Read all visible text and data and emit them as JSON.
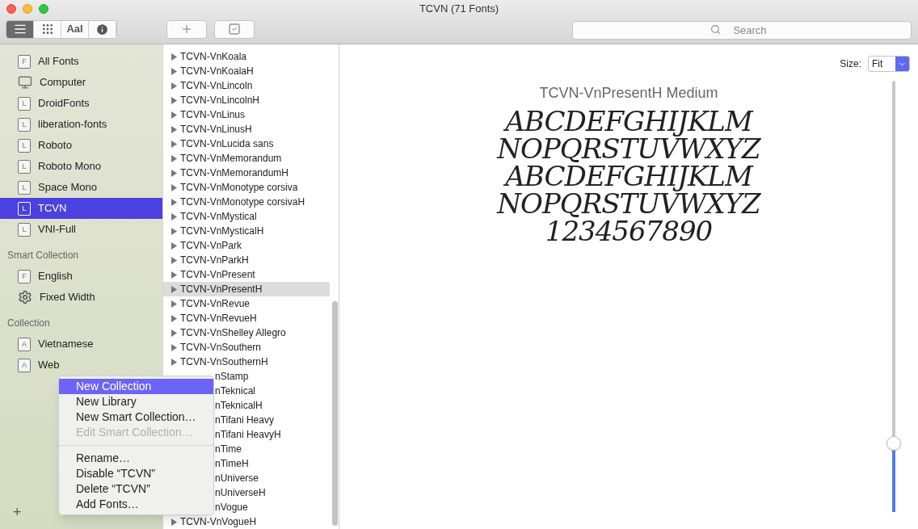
{
  "window": {
    "title": "TCVN (71 Fonts)"
  },
  "toolbar": {
    "view_modes": [
      {
        "kind": "list",
        "selected": true
      },
      {
        "kind": "grid",
        "selected": false
      },
      {
        "kind": "text",
        "label": "AaI",
        "selected": false
      },
      {
        "kind": "info",
        "selected": false
      }
    ],
    "actions": [
      {
        "kind": "add"
      },
      {
        "kind": "check"
      }
    ],
    "search": {
      "placeholder": "Search"
    }
  },
  "sidebar": {
    "sections": [
      {
        "items": [
          {
            "label": "All Fonts",
            "kind": "letter",
            "letter": "F",
            "selected": false
          },
          {
            "label": "Computer",
            "kind": "computer",
            "selected": false
          },
          {
            "label": "DroidFonts",
            "kind": "letter",
            "letter": "L",
            "selected": false
          },
          {
            "label": "liberation-fonts",
            "kind": "letter",
            "letter": "L",
            "selected": false
          },
          {
            "label": "Roboto",
            "kind": "letter",
            "letter": "L",
            "selected": false
          },
          {
            "label": "Roboto Mono",
            "kind": "letter",
            "letter": "L",
            "selected": false
          },
          {
            "label": "Space Mono",
            "kind": "letter",
            "letter": "L",
            "selected": false
          },
          {
            "label": "TCVN",
            "kind": "letter",
            "letter": "L",
            "selected": true
          },
          {
            "label": "VNI-Full",
            "kind": "letter",
            "letter": "L",
            "selected": false
          }
        ]
      },
      {
        "heading": "Smart Collection",
        "items": [
          {
            "label": "English",
            "kind": "letter",
            "letter": "F",
            "selected": false
          },
          {
            "label": "Fixed Width",
            "kind": "gear",
            "selected": false
          }
        ]
      },
      {
        "heading": "Collection",
        "items": [
          {
            "label": "Vietnamese",
            "kind": "letter",
            "letter": "A",
            "selected": false
          },
          {
            "label": "Web",
            "kind": "letter",
            "letter": "A",
            "selected": false
          }
        ]
      }
    ],
    "add_label": "+"
  },
  "font_list": [
    {
      "name": "TCVN-VnKoala",
      "selected": false
    },
    {
      "name": "TCVN-VnKoalaH",
      "selected": false
    },
    {
      "name": "TCVN-VnLincoln",
      "selected": false
    },
    {
      "name": "TCVN-VnLincolnH",
      "selected": false
    },
    {
      "name": "TCVN-VnLinus",
      "selected": false
    },
    {
      "name": "TCVN-VnLinusH",
      "selected": false
    },
    {
      "name": "TCVN-VnLucida sans",
      "selected": false
    },
    {
      "name": "TCVN-VnMemorandum",
      "selected": false
    },
    {
      "name": "TCVN-VnMemorandumH",
      "selected": false
    },
    {
      "name": "TCVN-VnMonotype corsiva",
      "selected": false
    },
    {
      "name": "TCVN-VnMonotype corsivaH",
      "selected": false
    },
    {
      "name": "TCVN-VnMystical",
      "selected": false
    },
    {
      "name": "TCVN-VnMysticalH",
      "selected": false
    },
    {
      "name": "TCVN-VnPark",
      "selected": false
    },
    {
      "name": "TCVN-VnParkH",
      "selected": false
    },
    {
      "name": "TCVN-VnPresent",
      "selected": false
    },
    {
      "name": "TCVN-VnPresentH",
      "selected": true
    },
    {
      "name": "TCVN-VnRevue",
      "selected": false
    },
    {
      "name": "TCVN-VnRevueH",
      "selected": false
    },
    {
      "name": "TCVN-VnShelley Allegro",
      "selected": false
    },
    {
      "name": "TCVN-VnSouthern",
      "selected": false
    },
    {
      "name": "TCVN-VnSouthernH",
      "selected": false
    },
    {
      "name": "nStamp",
      "selected": false,
      "covered": true
    },
    {
      "name": "nTeknical",
      "selected": false,
      "covered": true
    },
    {
      "name": "nTeknicalH",
      "selected": false,
      "covered": true
    },
    {
      "name": "nTifani Heavy",
      "selected": false,
      "covered": true
    },
    {
      "name": "nTifani HeavyH",
      "selected": false,
      "covered": true
    },
    {
      "name": "nTime",
      "selected": false,
      "covered": true
    },
    {
      "name": "nTimeH",
      "selected": false,
      "covered": true
    },
    {
      "name": "nUniverse",
      "selected": false,
      "covered": true
    },
    {
      "name": "nUniverseH",
      "selected": false,
      "covered": true
    },
    {
      "name": "nVogue",
      "selected": false,
      "covered": true
    },
    {
      "name": "TCVN-VnVogueH",
      "selected": false
    }
  ],
  "preview": {
    "size_label": "Size:",
    "size_value": "Fit",
    "font_title": "TCVN-VnPresentH Medium",
    "sample_lines": [
      "ABCDEFGHIJKLM",
      "NOPQRSTUVWXYZ",
      "ABCDEFGHIJKLM",
      "NOPQRSTUVWXYZ",
      "1234567890"
    ],
    "size_slider": {
      "level": 0.16
    }
  },
  "context_menu": [
    {
      "kind": "item",
      "label": "New Collection",
      "selected": true,
      "disabled": false
    },
    {
      "kind": "item",
      "label": "New Library",
      "selected": false,
      "disabled": false
    },
    {
      "kind": "item",
      "label": "New Smart Collection…",
      "selected": false,
      "disabled": false
    },
    {
      "kind": "item",
      "label": "Edit Smart Collection…",
      "selected": false,
      "disabled": true
    },
    {
      "kind": "separator"
    },
    {
      "kind": "item",
      "label": "Rename…",
      "selected": false,
      "disabled": false
    },
    {
      "kind": "item",
      "label": "Disable “TCVN”",
      "selected": false,
      "disabled": false
    },
    {
      "kind": "item",
      "label": "Delete “TCVN”",
      "selected": false,
      "disabled": false
    },
    {
      "kind": "item",
      "label": "Add Fonts…",
      "selected": false,
      "disabled": false
    }
  ]
}
